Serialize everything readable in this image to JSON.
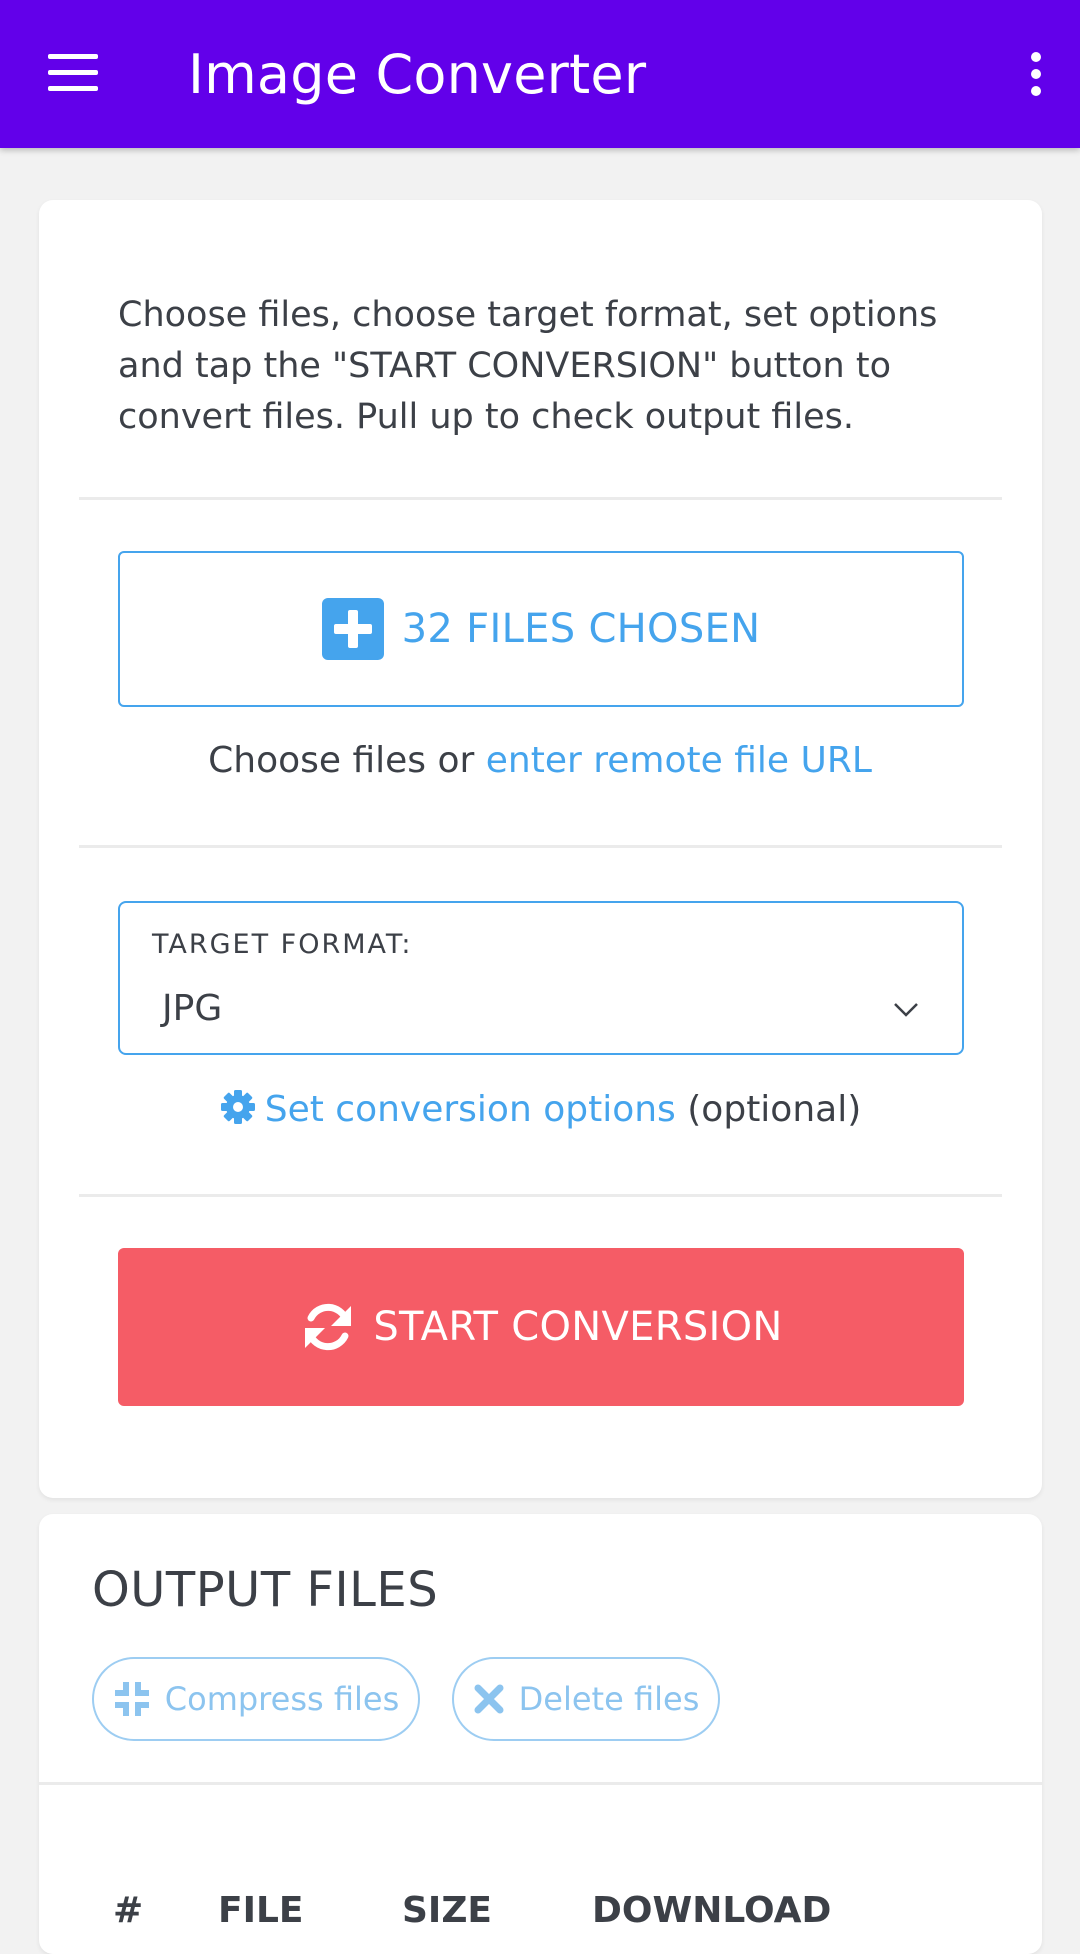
{
  "appbar": {
    "title": "Image Converter"
  },
  "intro": {
    "text": "Choose files, choose target format, set options and tap the \"START CONVERSION\" button to convert files. Pull up to check output files."
  },
  "upload": {
    "button_label": "32 FILES CHOSEN",
    "sub_prefix": "Choose files or",
    "remote_link": "enter remote file URL"
  },
  "format": {
    "label": "TARGET FORMAT:",
    "value": "JPG"
  },
  "options": {
    "link": "Set conversion options",
    "suffix": "(optional)"
  },
  "convert": {
    "button_label": "START CONVERSION"
  },
  "colors": {
    "appbar": "#6200ea",
    "accent": "#45a4ed",
    "start": "#f55c66"
  },
  "output": {
    "title": "OUTPUT FILES",
    "compress_label": "Compress files",
    "delete_label": "Delete files",
    "columns": [
      "#",
      "FILE",
      "SIZE",
      "DOWNLOAD"
    ]
  }
}
